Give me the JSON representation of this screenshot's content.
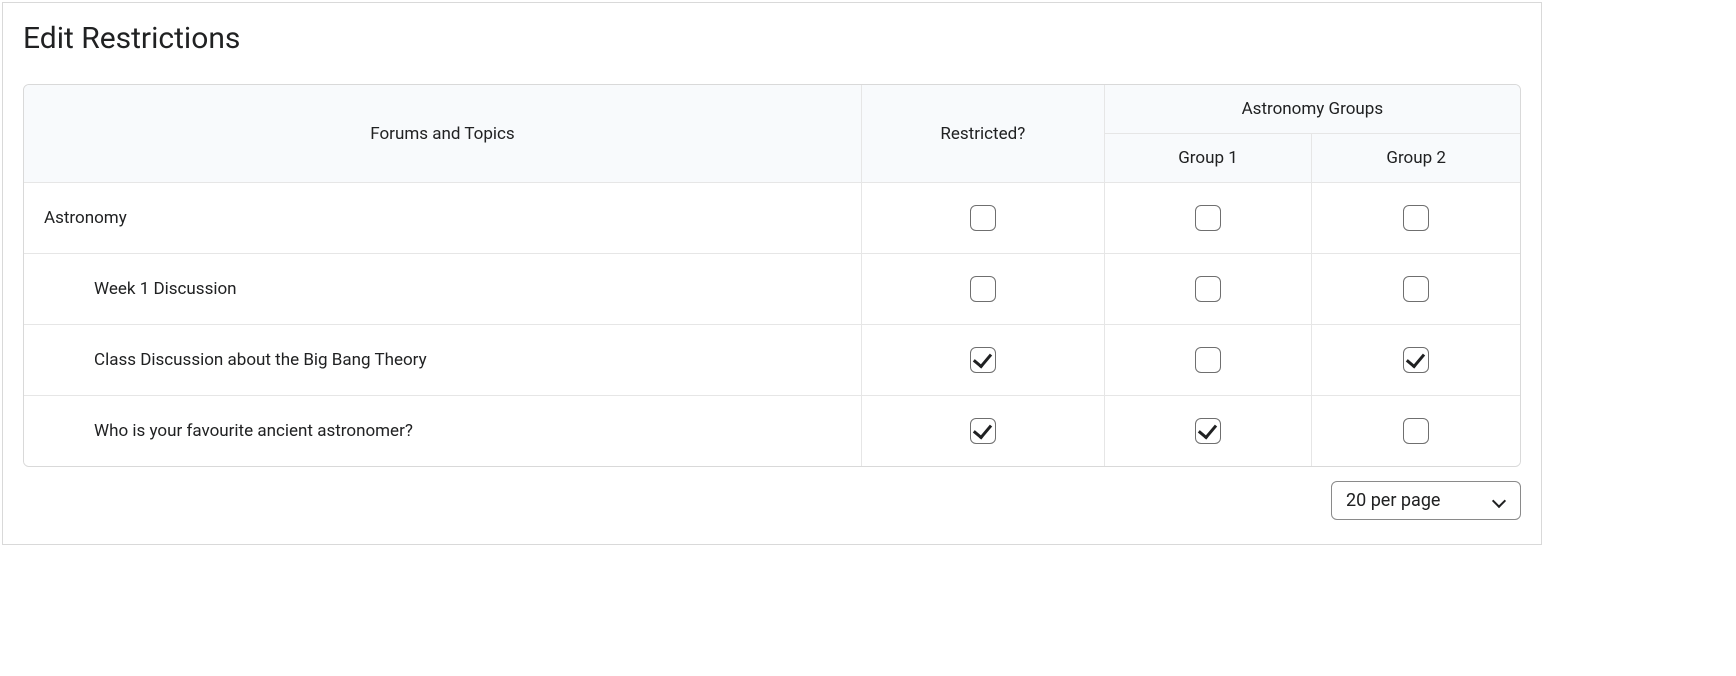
{
  "title": "Edit Restrictions",
  "columns": {
    "forums": "Forums and Topics",
    "restricted": "Restricted?",
    "groupCategory": "Astronomy Groups",
    "group1": "Group 1",
    "group2": "Group 2"
  },
  "rows": [
    {
      "name": "Astronomy",
      "indent": false,
      "restricted": false,
      "group1": false,
      "group2": false
    },
    {
      "name": "Week 1 Discussion",
      "indent": true,
      "restricted": false,
      "group1": false,
      "group2": false
    },
    {
      "name": "Class Discussion about the Big Bang Theory",
      "indent": true,
      "restricted": true,
      "group1": false,
      "group2": true
    },
    {
      "name": "Who is your favourite ancient astronomer?",
      "indent": true,
      "restricted": true,
      "group1": true,
      "group2": false
    }
  ],
  "pager": {
    "perPageLabel": "20 per page"
  }
}
